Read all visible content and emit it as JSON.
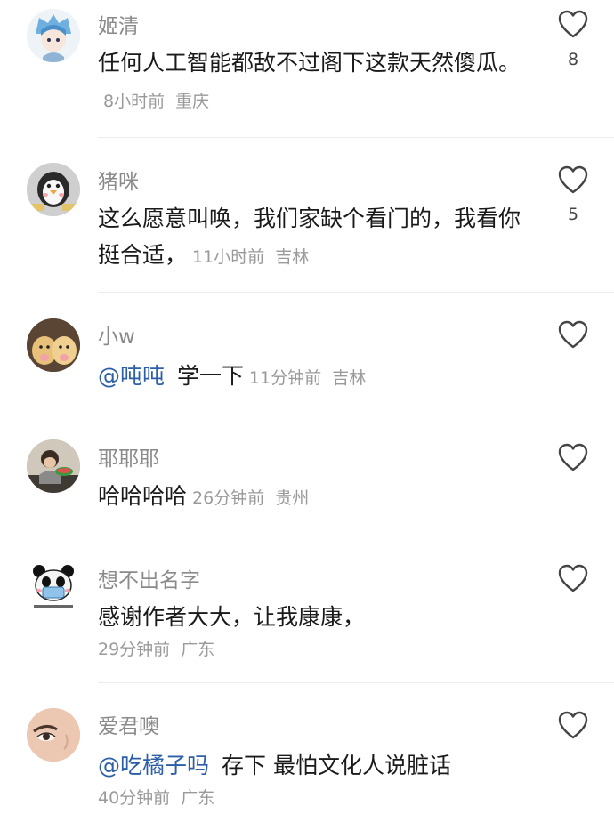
{
  "comments": [
    {
      "username": "姬清",
      "text": "任何人工智能都敌不过阁下这款天然傻瓜。",
      "time": "8小时前",
      "location": "重庆",
      "likes": "8",
      "avatar_icon": "anime-boy-avatar"
    },
    {
      "username": "猪咪",
      "text": "这么愿意叫唤，我们家缺个看门的，我看你挺合适，",
      "time": "11小时前",
      "location": "吉林",
      "likes": "5",
      "avatar_icon": "penguin-avatar"
    },
    {
      "username": "小w",
      "mention": "@吨吨",
      "text": "学一下",
      "time": "11分钟前",
      "location": "吉林",
      "avatar_icon": "puppies-avatar"
    },
    {
      "username": "耶耶耶",
      "text": "哈哈哈哈",
      "time": "26分钟前",
      "location": "贵州",
      "avatar_icon": "child-eating-avatar"
    },
    {
      "username": "想不出名字",
      "text": "感谢作者大大，让我康康，",
      "time": "29分钟前",
      "location": "广东",
      "avatar_icon": "panda-mask-avatar"
    },
    {
      "username": "爱君噢",
      "mention": "@吃橘子吗",
      "text": "存下 最怕文化人说脏话",
      "time": "40分钟前",
      "location": "广东",
      "avatar_icon": "face-closeup-avatar"
    }
  ],
  "colors": {
    "username": "#8a8a8a",
    "mention": "#2d5fa8",
    "meta": "#9a9a9a",
    "divider": "#ececec"
  }
}
